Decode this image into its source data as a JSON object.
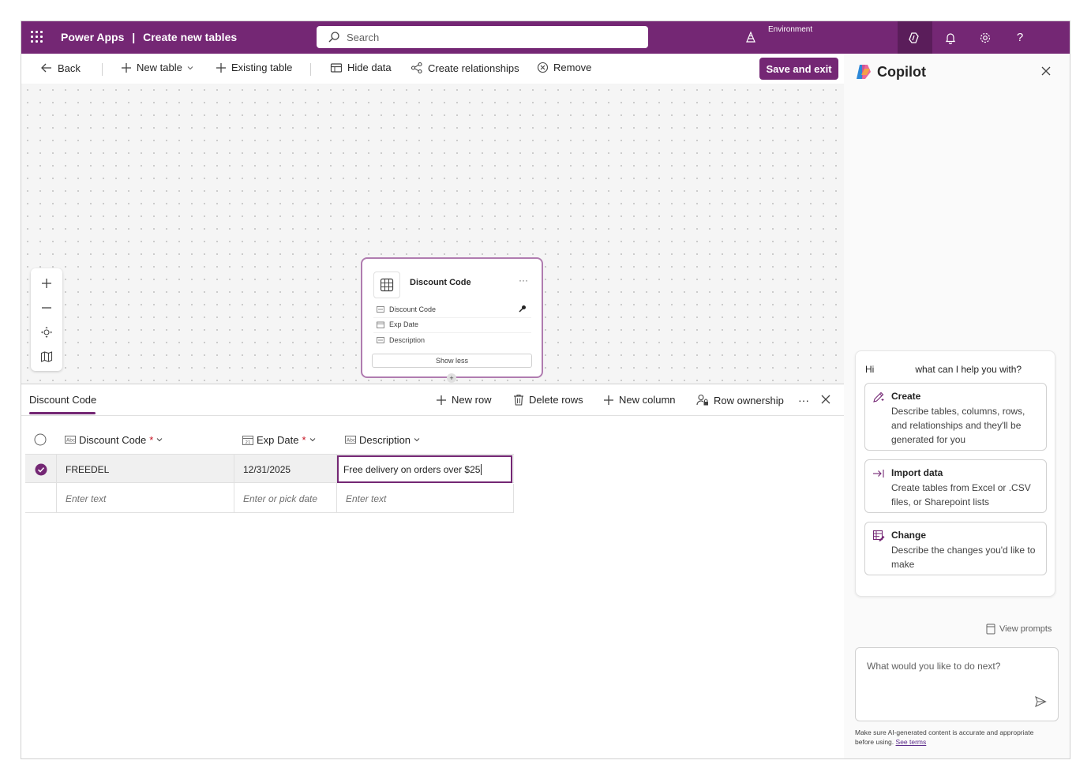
{
  "header": {
    "app_name": "Power Apps",
    "separator": "|",
    "page_title": "Create new tables",
    "search_placeholder": "Search",
    "environment_label": "Environment"
  },
  "toolbar": {
    "back": "Back",
    "new_table": "New table",
    "existing_table": "Existing table",
    "hide_data": "Hide data",
    "create_relationships": "Create relationships",
    "remove": "Remove",
    "save_and_exit": "Save and exit"
  },
  "table_card": {
    "title": "Discount Code",
    "more": "···",
    "fields": [
      "Discount Code",
      "Exp Date",
      "Description"
    ],
    "show_less": "Show less"
  },
  "grid_panel": {
    "tab": "Discount Code",
    "new_row": "New row",
    "delete_rows": "Delete rows",
    "new_column": "New column",
    "row_ownership": "Row ownership",
    "more": "···",
    "columns": [
      {
        "label": "Discount Code",
        "required": "*"
      },
      {
        "label": "Exp Date",
        "required": "*"
      },
      {
        "label": "Description",
        "required": ""
      }
    ],
    "rows": [
      {
        "discount_code": "FREEDEL",
        "exp_date": "12/31/2025",
        "description": "Free delivery on orders over $25"
      }
    ],
    "empty_row": {
      "discount_code": "Enter text",
      "exp_date": "Enter or pick date",
      "description": "Enter text"
    }
  },
  "copilot": {
    "title": "Copilot",
    "greeting_start": "Hi",
    "greeting_end": "what can I help you with?",
    "options": [
      {
        "title": "Create",
        "description": "Describe tables, columns, rows, and relationships and they'll be generated for you"
      },
      {
        "title": "Import data",
        "description": "Create tables from Excel or .CSV files, or Sharepoint lists"
      },
      {
        "title": "Change",
        "description": "Describe the changes you'd like to make"
      }
    ],
    "view_prompts": "View prompts",
    "input_placeholder": "What would you like to do next?",
    "disclaimer": "Make sure AI-generated content is accurate and appropriate before using.",
    "see_terms": "See terms"
  },
  "colors": {
    "brand": "#742774",
    "brand_dark": "#5a1d5a"
  }
}
